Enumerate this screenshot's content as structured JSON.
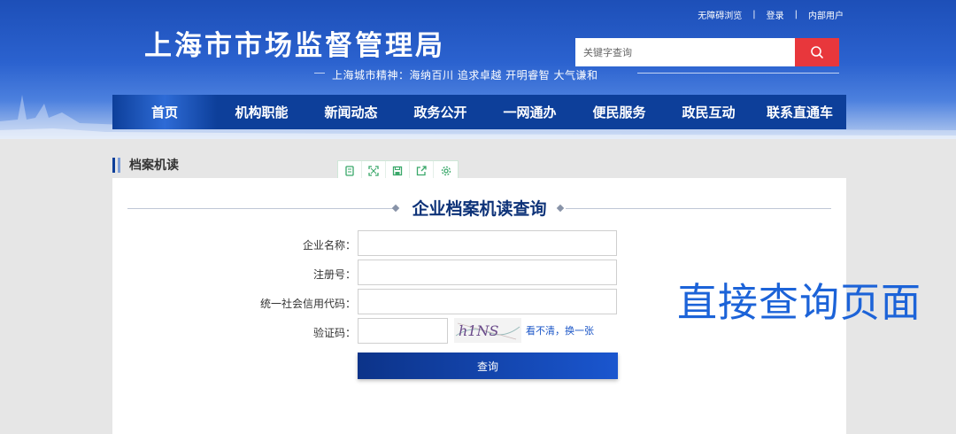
{
  "header": {
    "title": "上海市市场监督管理局",
    "motto": "上海城市精神：海纳百川  追求卓越  开明睿智  大气谦和",
    "top_links": [
      "无障碍浏览",
      "登录",
      "内部用户"
    ],
    "separator": "|",
    "search_placeholder": "关键字查询"
  },
  "nav": {
    "items": [
      "首页",
      "机构职能",
      "新闻动态",
      "政务公开",
      "一网通办",
      "便民服务",
      "政民互动",
      "联系直通车"
    ],
    "active_index": 0
  },
  "section": {
    "label": "档案机读"
  },
  "toolbar": {
    "icons": [
      "document-icon",
      "fullscreen-icon",
      "save-icon",
      "share-icon",
      "settings-icon"
    ]
  },
  "form": {
    "title": "企业档案机读查询",
    "fields": [
      {
        "label": "企业名称：",
        "value": ""
      },
      {
        "label": "注册号：",
        "value": ""
      },
      {
        "label": "统一社会信用代码：",
        "value": ""
      },
      {
        "label": "验证码：",
        "value": ""
      }
    ],
    "captcha_text": "h1NS",
    "refresh_label": "看不清，换一张",
    "submit_label": "查询"
  },
  "overlay_caption": "直接查询页面",
  "colors": {
    "nav_bg": "#0d3f9a",
    "search_btn": "#e8373c",
    "title_text": "#0d3278",
    "caption": "#1c63d8"
  }
}
